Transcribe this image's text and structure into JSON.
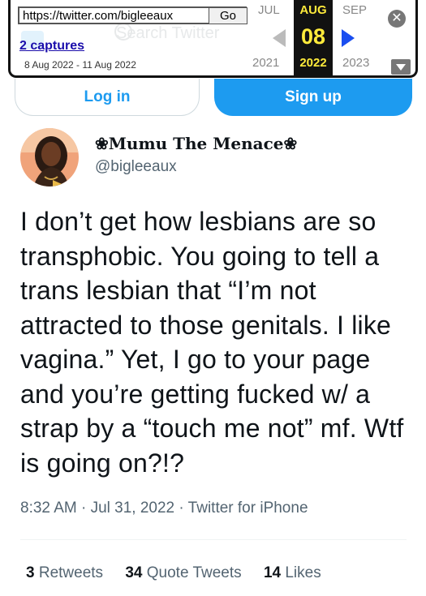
{
  "wayback": {
    "url": "https://twitter.com/bigleeaux",
    "go_label": "Go",
    "captures": "2 captures",
    "date_range": "8 Aug 2022 - 11 Aug 2022",
    "prev_month": "JUL",
    "current_month": "AUG",
    "next_month": "SEP",
    "current_day": "08",
    "prev_year": "2021",
    "current_year": "2022",
    "next_year": "2023",
    "close_glyph": "✕",
    "ghost_search": "Search Twitter"
  },
  "auth": {
    "login_label": "Log in",
    "signup_label": "Sign up"
  },
  "tweet": {
    "display_name": "❀Mumu The Menace❀",
    "handle": "@bigleeaux",
    "text": "I don’t get how lesbians are so transphobic. You going to tell a trans lesbian that “I’m not attracted to those genitals. I like vagina.” Yet, I go to your page and you’re getting fucked w/ a strap by a “touch me not” mf. Wtf is going on?!?",
    "meta": "8:32 AM · Jul 31, 2022 · Twitter for iPhone",
    "stats": {
      "retweets_count": "3",
      "retweets_label": "Retweets",
      "quotes_count": "34",
      "quotes_label": "Quote Tweets",
      "likes_count": "14",
      "likes_label": "Likes"
    }
  },
  "colors": {
    "twitter_blue": "#1d9bf0",
    "wayback_highlight": "#ffeb3b",
    "secondary_text": "#536471"
  }
}
